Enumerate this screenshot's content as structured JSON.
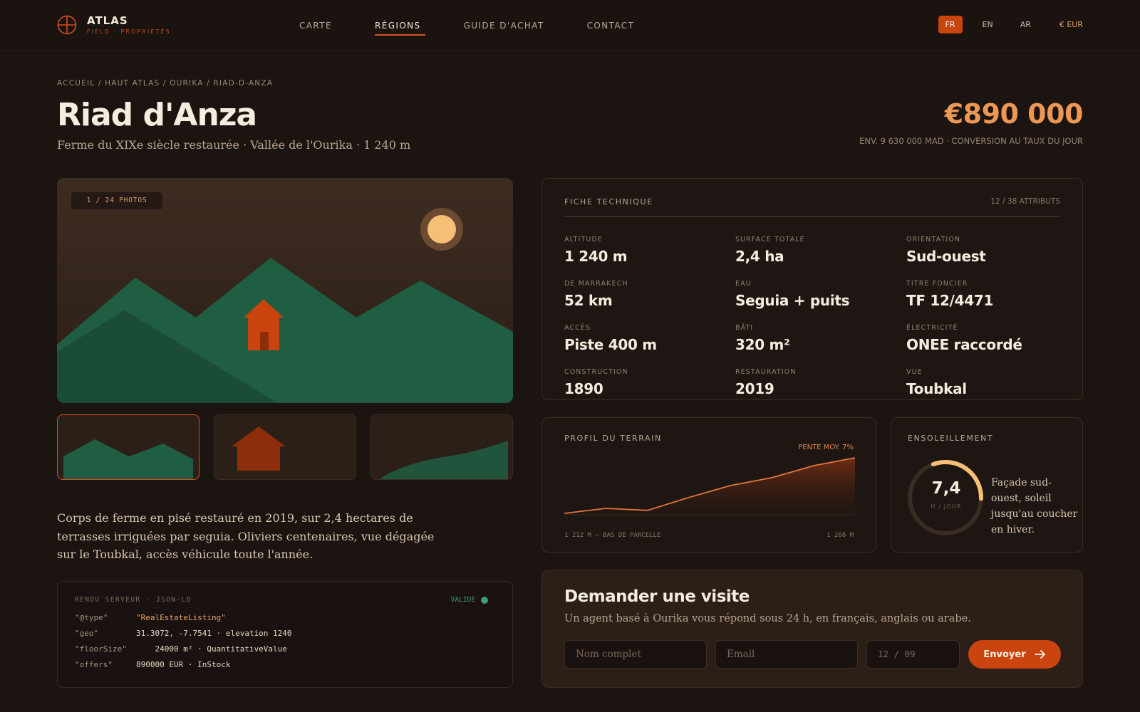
{
  "brand": {
    "name": "ATLAS",
    "tagline": "FIELD · PROPRIÉTÉS"
  },
  "nav": [
    "CARTE",
    "RÉGIONS",
    "GUIDE D'ACHAT",
    "CONTACT"
  ],
  "nav_active": "RÉGIONS",
  "languages": [
    "FR",
    "EN",
    "AR"
  ],
  "language_active": "FR",
  "currency": "€ EUR",
  "breadcrumb": "ACCUEIL / HAUT ATLAS / OURIKA / RIAD-D-ANZA",
  "listing": {
    "title": "Riad d'Anza",
    "subtitle": "Ferme du XIXe siècle restaurée · Vallée de l'Ourika · 1 240 m",
    "price": "€890 000",
    "price_note": "ENV. 9 630 000 MAD · CONVERSION AU TAUX DU JOUR",
    "photo_badge": "1 / 24 PHOTOS",
    "description": "Corps de ferme en pisé restauré en 2019, sur 2,4 hectares de terrasses irriguées par seguia. Oliviers centenaires, vue dégagée sur le Toubkal, accès véhicule toute l'année."
  },
  "jsonld": {
    "header": "RENDU SERVEUR · JSON-LD",
    "status": "VALIDE",
    "rows": [
      {
        "key": "\"@type\"",
        "value": "\"RealEstateListing\""
      },
      {
        "key": "\"geo\"",
        "value": "31.3072, -7.7541 · elevation 1240"
      },
      {
        "key": "\"floorSize\"",
        "value": "    24000 m² · QuantitativeValue"
      },
      {
        "key": "\"offers\"",
        "value": "890000 EUR · InStock"
      }
    ]
  },
  "tech": {
    "title": "FICHE TECHNIQUE",
    "count": "12 / 38 ATTRIBUTS",
    "attributes": [
      {
        "label": "ALTITUDE",
        "value": "1 240 m"
      },
      {
        "label": "SURFACE TOTALE",
        "value": "2,4 ha"
      },
      {
        "label": "ORIENTATION",
        "value": "Sud-ouest"
      },
      {
        "label": "DE MARRAKECH",
        "value": "52 km"
      },
      {
        "label": "EAU",
        "value": "Seguia + puits"
      },
      {
        "label": "TITRE FONCIER",
        "value": "TF 12/4471"
      },
      {
        "label": "ACCÈS",
        "value": "Piste 400 m"
      },
      {
        "label": "BÂTI",
        "value": "320 m²"
      },
      {
        "label": "ÉLECTRICITÉ",
        "value": "ONEE raccordé"
      },
      {
        "label": "CONSTRUCTION",
        "value": "1890"
      },
      {
        "label": "RESTAURATION",
        "value": "2019"
      },
      {
        "label": "VUE",
        "value": "Toubkal"
      }
    ]
  },
  "terrain": {
    "title": "PROFIL DU TERRAIN",
    "slope": "PENTE MOY. 7%",
    "low_label": "1 212 M — BAS DE PARCELLE",
    "high_label": "1 268 M",
    "profile": [
      1212,
      1217,
      1215,
      1228,
      1240,
      1248,
      1260,
      1268
    ]
  },
  "sun": {
    "title": "ENSOLEILLEMENT",
    "value": "7,4",
    "unit": "H / JOUR",
    "fraction": 0.31,
    "text": "Façade sud-ouest, soleil jusqu'au coucher en hiver."
  },
  "visit": {
    "title": "Demander une visite",
    "subtitle": "Un agent basé à Ourika vous répond sous 24 h, en français, anglais ou arabe.",
    "name_placeholder": "Nom complet",
    "email_placeholder": "Email",
    "date_placeholder": "12 / 09",
    "submit": "Envoyer"
  },
  "colors": {
    "accent": "#c9440f",
    "price": "#eb9855",
    "mountain": "#1f5e43",
    "valid": "#3f9a76"
  }
}
